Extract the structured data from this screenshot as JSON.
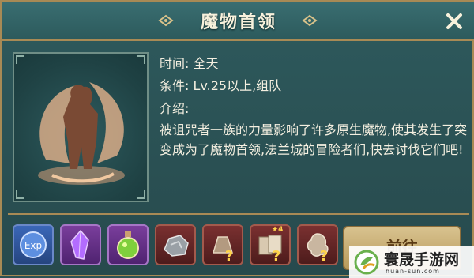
{
  "header": {
    "title": "魔物首领"
  },
  "info": {
    "time_label": "时间:",
    "time_value": "全天",
    "condition_label": "条件:",
    "condition_value": "Lv.25以上,组队",
    "intro_label": "介绍:",
    "description": "被诅咒者一族的力量影响了许多原生魔物,使其发生了突变成为了魔物首领,法兰城的冒险者们,快去讨伐它们吧!"
  },
  "rewards": [
    {
      "icon": "exp-icon",
      "label": "Exp",
      "rarity": "blue"
    },
    {
      "icon": "purple-crystal-icon",
      "rarity": "purple"
    },
    {
      "icon": "potion-bottle-icon",
      "rarity": "purple"
    },
    {
      "icon": "ore-stone-icon",
      "rarity": "red"
    },
    {
      "icon": "mystery-equipment-icon",
      "rarity": "red"
    },
    {
      "icon": "mystery-card-pack-icon",
      "rarity": "red",
      "badge": "4"
    },
    {
      "icon": "mystery-accessory-icon",
      "rarity": "red"
    }
  ],
  "goto_button": {
    "label": "前往"
  },
  "watermark": {
    "text": "寰晟手游网",
    "url": "huan-sun.com"
  },
  "colors": {
    "panel": "#2d5255",
    "border_gold": "#a88a55",
    "text": "#f4efe0",
    "button": "#c8ad74"
  }
}
